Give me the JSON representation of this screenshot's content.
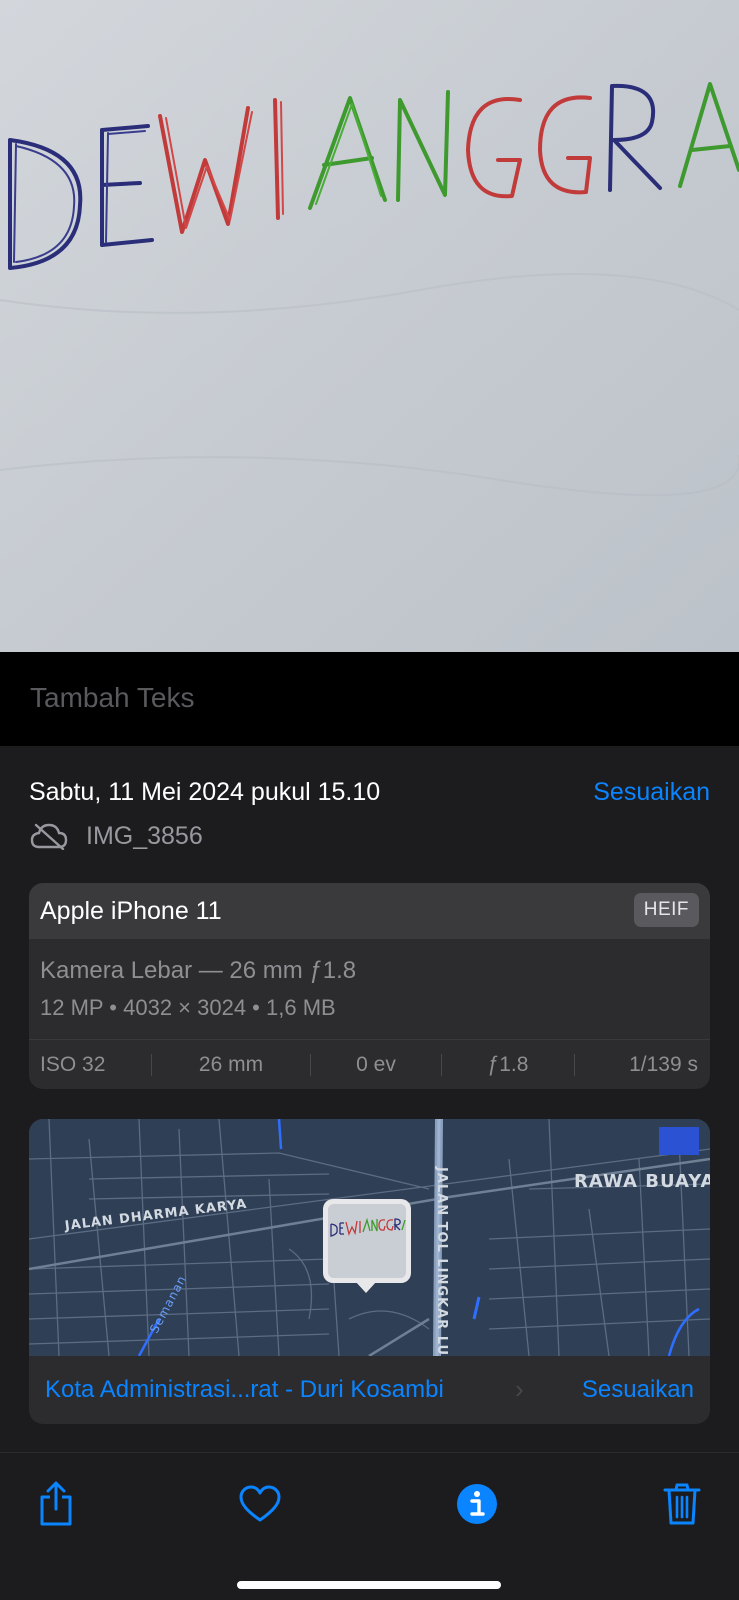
{
  "photo": {
    "handwritten_text": "DEWI ANGGRA"
  },
  "caption": {
    "placeholder": "Tambah Teks"
  },
  "info": {
    "date": "Sabtu, 11 Mei 2024 pukul 15.10",
    "adjust_label": "Sesuaikan",
    "filename": "IMG_3856",
    "icon": "cloud-slash-icon"
  },
  "device": {
    "name": "Apple iPhone 11",
    "format": "HEIF",
    "lens": "Kamera Lebar — 26 mm ƒ1.8",
    "specs": "12 MP  •  4032 × 3024  •  1,6 MB",
    "exif": [
      "ISO 32",
      "26 mm",
      "0 ev",
      "ƒ1.8",
      "1/139 s"
    ]
  },
  "map": {
    "labels": {
      "area": "RAWA BUAYA",
      "street1": "JALAN DHARMA KARYA",
      "street2": "JALAN TOL LINGKAR LU",
      "street3": "Semanan"
    },
    "location": "Kota Administrasi...rat - Duri Kosambi",
    "chevron": "›",
    "adjust_label": "Sesuaikan"
  },
  "toolbar": {
    "buttons": [
      "share-icon",
      "heart-icon",
      "info-icon",
      "trash-icon"
    ]
  },
  "colors": {
    "accent": "#0a84ff",
    "panel": "#1c1c1e",
    "card": "#2c2c2e"
  }
}
